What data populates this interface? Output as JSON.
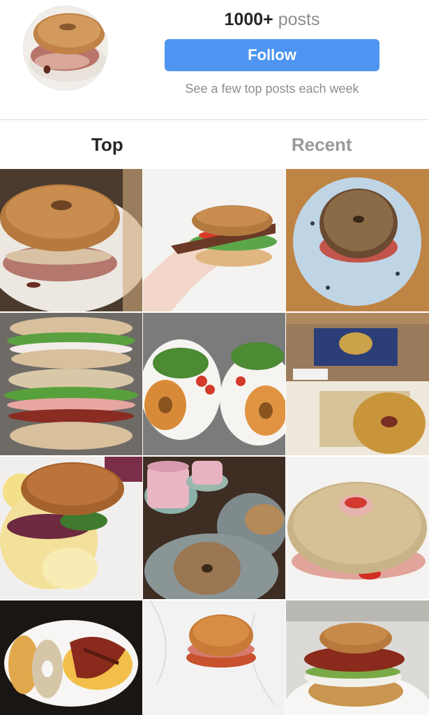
{
  "profile": {
    "post_count_number": "1000+",
    "post_count_unit": "posts",
    "follow_label": "Follow",
    "subtitle": "See a few top posts each week"
  },
  "tabs": [
    {
      "label": "Top",
      "active": true
    },
    {
      "label": "Recent",
      "active": false
    }
  ],
  "colors": {
    "follow_button": "#4d95f0",
    "active_tab": "#262626",
    "inactive_tab": "#999999",
    "muted_text": "#8e8e8e"
  },
  "grid_posts": [
    {
      "subject": "bagel sandwich with ham"
    },
    {
      "subject": "hand holding bagel with bacon and tomato"
    },
    {
      "subject": "everything bagel on blue plate"
    },
    {
      "subject": "stacked bagel sandwiches"
    },
    {
      "subject": "two bagels with salad on plates"
    },
    {
      "subject": "packaged bagel thins and bagel"
    },
    {
      "subject": "bagel with scrambled egg"
    },
    {
      "subject": "pink latte and sesame bagels"
    },
    {
      "subject": "large bagel with ham"
    },
    {
      "subject": "bagels with bacon on plate"
    },
    {
      "subject": "glazed bagel on marble"
    },
    {
      "subject": "bagel with bacon and avocado"
    }
  ]
}
